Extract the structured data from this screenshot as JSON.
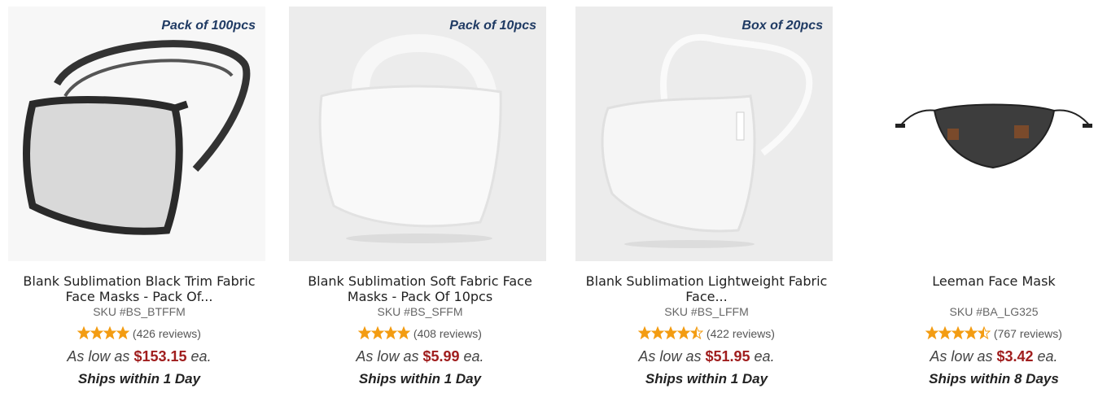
{
  "products": [
    {
      "badge": "Pack of 100pcs",
      "title": "Blank Sublimation Black Trim Fabric Face Masks - Pack Of...",
      "sku": "SKU #BS_BTFFM",
      "stars": 4,
      "reviews": "(426 reviews)",
      "price_prefix": "As low as",
      "price": "$153.15",
      "price_suffix": "ea.",
      "shipping": "Ships within 1 Day"
    },
    {
      "badge": "Pack of 10pcs",
      "title": "Blank Sublimation Soft Fabric Face Masks - Pack Of 10pcs",
      "sku": "SKU #BS_SFFM",
      "stars": 4,
      "reviews": "(408 reviews)",
      "price_prefix": "As low as",
      "price": "$5.99",
      "price_suffix": "ea.",
      "shipping": "Ships within 1 Day"
    },
    {
      "badge": "Box of 20pcs",
      "title": "Blank Sublimation Lightweight Fabric Face...",
      "sku": "SKU #BS_LFFM",
      "stars": 4.5,
      "reviews": "(422 reviews)",
      "price_prefix": "As low as",
      "price": "$51.95",
      "price_suffix": "ea.",
      "shipping": "Ships within 1 Day"
    },
    {
      "badge": "",
      "title": "Leeman Face Mask",
      "sku": "SKU #BA_LG325",
      "stars": 4.5,
      "reviews": "(767 reviews)",
      "price_prefix": "As low as",
      "price": "$3.42",
      "price_suffix": "ea.",
      "shipping": "Ships within 8 Days"
    }
  ],
  "colors": {
    "badge": "#1f3a63",
    "price": "#a01e1e",
    "star": "#f39c12"
  }
}
